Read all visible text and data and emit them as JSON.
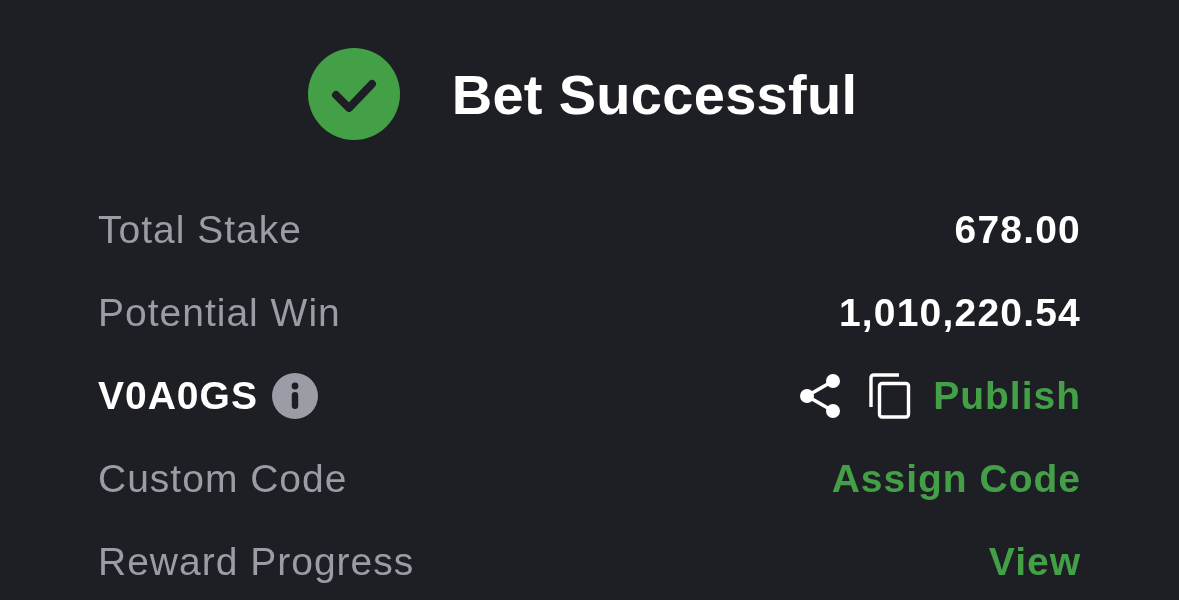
{
  "header": {
    "title": "Bet Successful"
  },
  "rows": [
    {
      "kind": "value",
      "label": "Total Stake",
      "value": "678.00"
    },
    {
      "kind": "value",
      "label": "Potential Win",
      "value": "1,010,220.54"
    },
    {
      "kind": "code",
      "code": "V0A0GS",
      "action": "Publish"
    },
    {
      "kind": "link",
      "label": "Custom Code",
      "action": "Assign Code"
    },
    {
      "kind": "link",
      "label": "Reward Progress",
      "action": "View"
    }
  ]
}
